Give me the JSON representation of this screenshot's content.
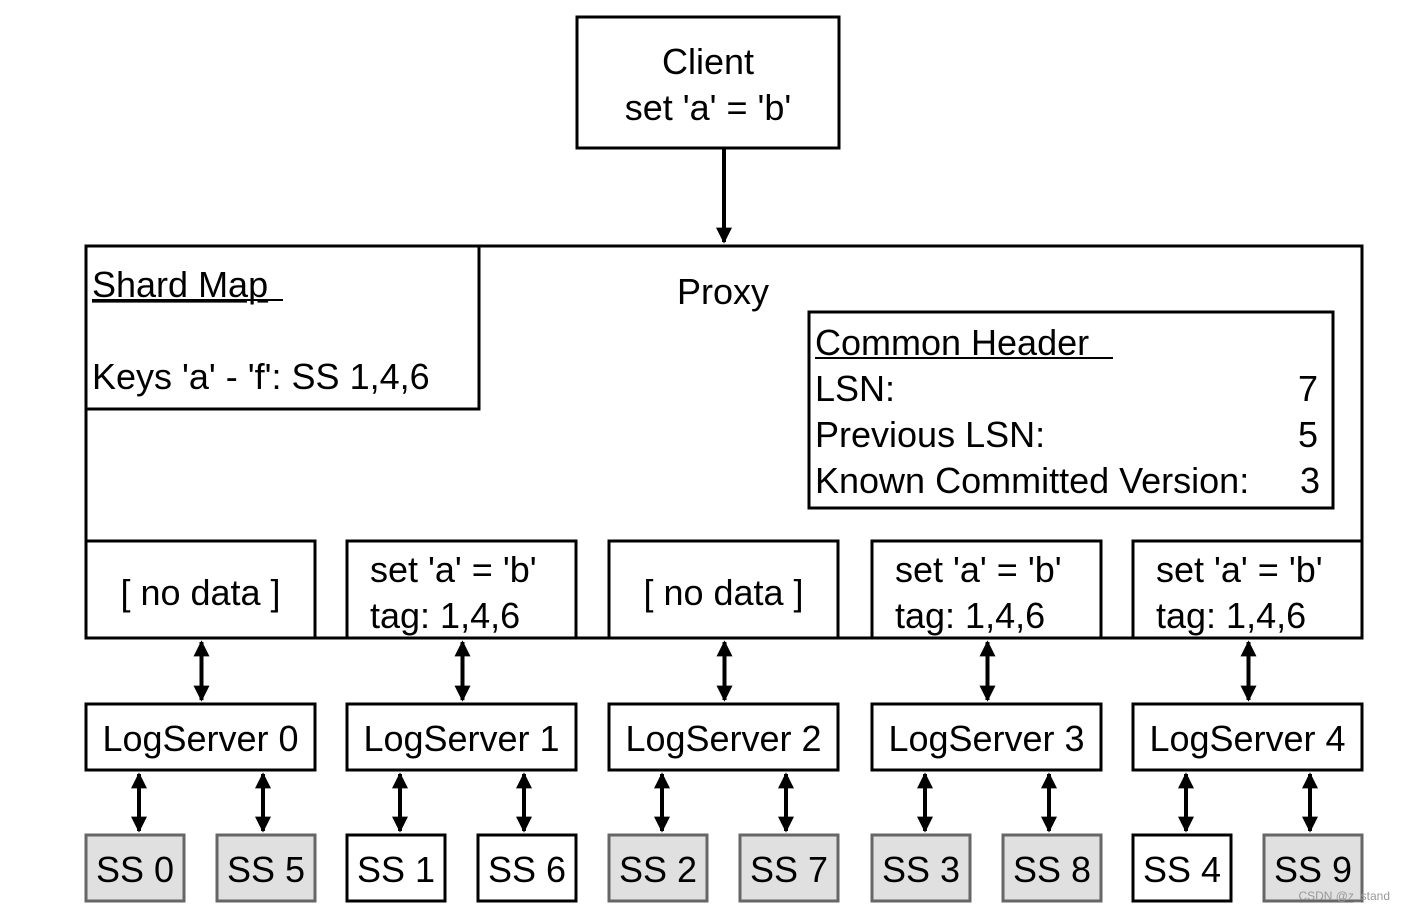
{
  "client": {
    "lines": [
      "Client",
      "set 'a' = 'b'"
    ]
  },
  "proxy": {
    "label": "Proxy"
  },
  "shard_map": {
    "title": "Shard Map",
    "line": "Keys 'a' - 'f': SS 1,4,6"
  },
  "common_header": {
    "title": "Common Header",
    "rows": [
      {
        "label": "LSN:",
        "value": "7"
      },
      {
        "label": "Previous LSN:",
        "value": "5"
      },
      {
        "label": "Known Committed Version:",
        "value": "3"
      }
    ]
  },
  "slots": [
    {
      "lines": [
        "[ no data ]"
      ]
    },
    {
      "lines": [
        "set 'a' = 'b'",
        "tag: 1,4,6"
      ]
    },
    {
      "lines": [
        "[ no data ]"
      ]
    },
    {
      "lines": [
        "set 'a' = 'b'",
        "tag: 1,4,6"
      ]
    },
    {
      "lines": [
        "set 'a' = 'b'",
        "tag: 1,4,6"
      ]
    }
  ],
  "log_servers": [
    "LogServer 0",
    "LogServer 1",
    "LogServer 2",
    "LogServer 3",
    "LogServer 4"
  ],
  "storage_servers": [
    {
      "label": "SS 0",
      "tagged": false
    },
    {
      "label": "SS 5",
      "tagged": false
    },
    {
      "label": "SS 1",
      "tagged": true
    },
    {
      "label": "SS 6",
      "tagged": true
    },
    {
      "label": "SS 2",
      "tagged": false
    },
    {
      "label": "SS 7",
      "tagged": false
    },
    {
      "label": "SS 3",
      "tagged": false
    },
    {
      "label": "SS 8",
      "tagged": false
    },
    {
      "label": "SS 4",
      "tagged": true
    },
    {
      "label": "SS 9",
      "tagged": false
    }
  ],
  "colors": {
    "stroke": "#000000",
    "inactive_fill": "#e0e0e0",
    "inactive_stroke": "#666666",
    "inactive_text": "#333333"
  },
  "watermark": "CSDN @z_stand"
}
